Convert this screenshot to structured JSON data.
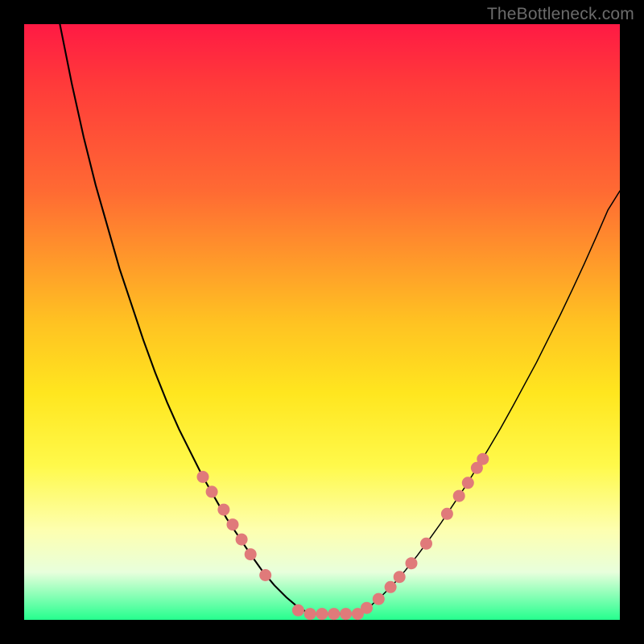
{
  "watermark": "TheBottleneck.com",
  "colors": {
    "background_frame": "#000000",
    "gradient_top": "#ff1a44",
    "gradient_bottom": "#25ff8e",
    "curve": "#000000",
    "marker": "#e07a7a"
  },
  "chart_data": {
    "type": "line",
    "title": "",
    "xlabel": "",
    "ylabel": "",
    "xlim": [
      0,
      100
    ],
    "ylim": [
      0,
      100
    ],
    "series": [
      {
        "name": "left-curve",
        "x": [
          6,
          8,
          10,
          12,
          14,
          16,
          18,
          20,
          22,
          24,
          26,
          28,
          30,
          32,
          34,
          36,
          38,
          40,
          42,
          44,
          46,
          48
        ],
        "y": [
          100,
          90,
          81,
          73,
          66,
          59,
          53,
          47,
          41.5,
          36.5,
          32,
          28,
          24,
          20.5,
          17,
          14,
          11,
          8.2,
          5.8,
          3.8,
          2.1,
          1
        ]
      },
      {
        "name": "flat-minimum",
        "x": [
          48,
          50,
          52,
          54,
          56
        ],
        "y": [
          1,
          1,
          1,
          1,
          1
        ]
      },
      {
        "name": "right-curve",
        "x": [
          56,
          58,
          60,
          62,
          64,
          66,
          68,
          70,
          72,
          74,
          76,
          78,
          80,
          82,
          84,
          86,
          88,
          90,
          92,
          94,
          96,
          98,
          100
        ],
        "y": [
          1,
          2.2,
          4,
          6,
          8.3,
          10.8,
          13.5,
          16.3,
          19.3,
          22.3,
          25.5,
          28.8,
          32.2,
          35.8,
          39.5,
          43.2,
          47.2,
          51.2,
          55.4,
          59.7,
          64.2,
          68.8,
          72
        ]
      }
    ],
    "markers": [
      {
        "series": "left-curve",
        "x": 30,
        "y": 24
      },
      {
        "series": "left-curve",
        "x": 31.5,
        "y": 21.5
      },
      {
        "series": "left-curve",
        "x": 33.5,
        "y": 18.5
      },
      {
        "series": "left-curve",
        "x": 35,
        "y": 16
      },
      {
        "series": "left-curve",
        "x": 36.5,
        "y": 13.5
      },
      {
        "series": "left-curve",
        "x": 38,
        "y": 11
      },
      {
        "series": "left-curve",
        "x": 40.5,
        "y": 7.5
      },
      {
        "series": "flat-minimum",
        "x": 46,
        "y": 1.6
      },
      {
        "series": "flat-minimum",
        "x": 48,
        "y": 1
      },
      {
        "series": "flat-minimum",
        "x": 50,
        "y": 1
      },
      {
        "series": "flat-minimum",
        "x": 52,
        "y": 1
      },
      {
        "series": "flat-minimum",
        "x": 54,
        "y": 1
      },
      {
        "series": "flat-minimum",
        "x": 56,
        "y": 1
      },
      {
        "series": "right-curve",
        "x": 57.5,
        "y": 2
      },
      {
        "series": "right-curve",
        "x": 59.5,
        "y": 3.5
      },
      {
        "series": "right-curve",
        "x": 61.5,
        "y": 5.5
      },
      {
        "series": "right-curve",
        "x": 63,
        "y": 7.2
      },
      {
        "series": "right-curve",
        "x": 65,
        "y": 9.5
      },
      {
        "series": "right-curve",
        "x": 67.5,
        "y": 12.8
      },
      {
        "series": "right-curve",
        "x": 71,
        "y": 17.8
      },
      {
        "series": "right-curve",
        "x": 73,
        "y": 20.8
      },
      {
        "series": "right-curve",
        "x": 74.5,
        "y": 23
      },
      {
        "series": "right-curve",
        "x": 76,
        "y": 25.5
      },
      {
        "series": "right-curve",
        "x": 77,
        "y": 27
      }
    ]
  }
}
